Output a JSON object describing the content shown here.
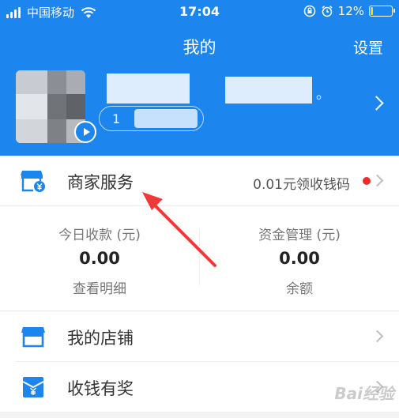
{
  "status_bar": {
    "carrier": "中国移动",
    "time": "17:04",
    "battery": "12%",
    "battery_level": 0.12,
    "icons": [
      "signal-icon",
      "wifi-icon",
      "lock-rotation-icon",
      "alarm-icon",
      "battery-icon"
    ]
  },
  "header": {
    "title": "我的",
    "settings_label": "设置",
    "name_suffix": "。",
    "account_prefix": "1",
    "background_color": "#1c86ee"
  },
  "merchant": {
    "label": "商家服务",
    "promo": "0.01元领收钱码",
    "icon": "store-yen-icon",
    "dot_color": "#f02b2b"
  },
  "stats": [
    {
      "label": "今日收款 (元)",
      "value": "0.00",
      "link": "查看明细"
    },
    {
      "label": "资金管理 (元)",
      "value": "0.00",
      "link": "余额"
    }
  ],
  "menu": [
    {
      "label": "我的店铺",
      "icon": "shop-icon"
    },
    {
      "label": "收钱有奖",
      "icon": "red-envelope-icon"
    }
  ],
  "watermark": "Bai经验"
}
